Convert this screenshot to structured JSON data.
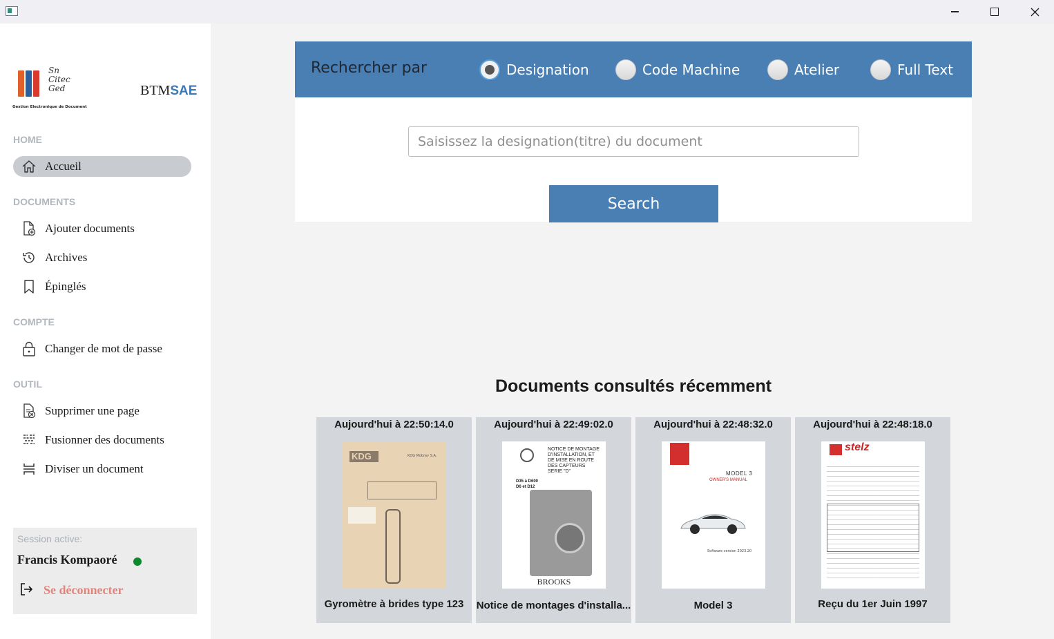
{
  "window": {
    "minimize_icon": "minimize-icon",
    "maximize_icon": "maximize-icon",
    "close_icon": "close-icon"
  },
  "sidebar": {
    "logo": {
      "script_lines": [
        "Sn",
        "Citec",
        "Ged"
      ],
      "tagline": "Gestion Electronique de Document"
    },
    "brand": {
      "prefix": "BTM",
      "suffix": "SAE",
      "suffix_color": "#3b78b5"
    },
    "sections": [
      {
        "label": "HOME",
        "items": [
          {
            "label": "Accueil",
            "icon": "home-icon",
            "active": true
          }
        ]
      },
      {
        "label": "DOCUMENTS",
        "items": [
          {
            "label": "Ajouter documents",
            "icon": "add-document-icon"
          },
          {
            "label": "Archives",
            "icon": "history-icon"
          },
          {
            "label": "Épinglés",
            "icon": "bookmark-icon"
          }
        ]
      },
      {
        "label": "COMPTE",
        "items": [
          {
            "label": "Changer de mot de passe",
            "icon": "lock-icon"
          }
        ]
      },
      {
        "label": "OUTIL",
        "items": [
          {
            "label": "Supprimer une page",
            "icon": "delete-page-icon"
          },
          {
            "label": "Fusionner des documents",
            "icon": "merge-icon"
          },
          {
            "label": "Diviser un document",
            "icon": "split-icon"
          }
        ]
      }
    ],
    "session": {
      "label": "Session active:",
      "user": "Francis Kompaoré",
      "status_color": "#0a8a2a",
      "logout_label": "Se déconnecter",
      "logout_color": "#e0857e"
    }
  },
  "search": {
    "title": "Rechercher par",
    "options": [
      {
        "label": "Designation",
        "checked": true
      },
      {
        "label": "Code Machine",
        "checked": false
      },
      {
        "label": "Atelier",
        "checked": false
      },
      {
        "label": "Full Text",
        "checked": false
      }
    ],
    "placeholder": "Saisissez la designation(titre) du document",
    "value": "",
    "button_label": "Search",
    "accent_color": "#4a7fb3"
  },
  "recent": {
    "title": "Documents consultés récemment",
    "cards": [
      {
        "date": "Aujourd'hui à 22:50:14.0",
        "name": "Gyromètre à brides type 123",
        "thumb_logo": "KDG",
        "thumb_company": "KDG Mobrey S.A."
      },
      {
        "date": "Aujourd'hui à 22:49:02.0",
        "name": "Notice de montages d'installa...",
        "thumb_lines": [
          "NOTICE DE MONTAGE",
          "D'INSTALLATION, ET",
          "DE MISE EN ROUTE",
          "DES CAPTEURS",
          "SERIE \"D\""
        ],
        "thumb_models": [
          "D35 à D600",
          "D6 et D12"
        ],
        "thumb_footer": "BROOKS"
      },
      {
        "date": "Aujourd'hui à 22:48:32.0",
        "name": "Model 3",
        "thumb_title": "MODEL 3",
        "thumb_subtitle": "OWNER'S MANUAL",
        "thumb_version": "Software version 2023.20"
      },
      {
        "date": "Aujourd'hui à 22:48:18.0",
        "name": "Reçu du 1er Juin 1997",
        "thumb_logo": "stelz"
      }
    ]
  }
}
